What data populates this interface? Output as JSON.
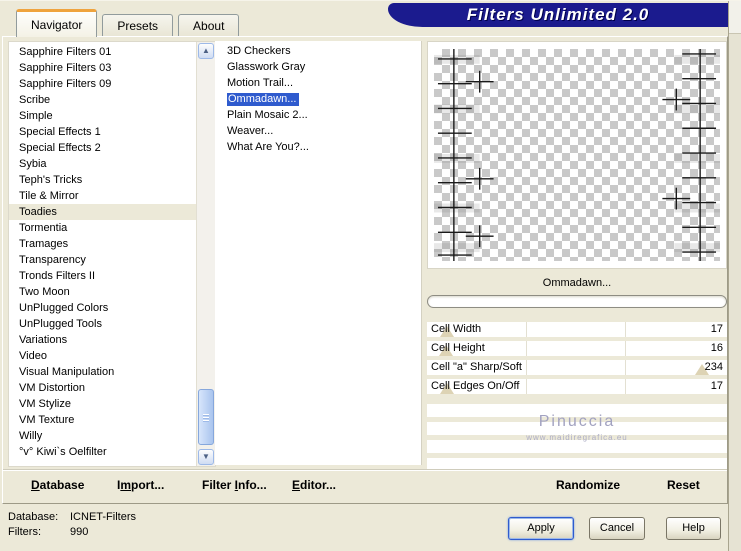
{
  "window": {
    "title_banner": "Filters Unlimited 2.0"
  },
  "tabs": [
    {
      "label": "Navigator",
      "active": true
    },
    {
      "label": "Presets",
      "active": false
    },
    {
      "label": "About",
      "active": false
    }
  ],
  "category_list": {
    "selected_index": 10,
    "items": [
      "Sapphire Filters 01",
      "Sapphire Filters 03",
      "Sapphire Filters 09",
      "Scribe",
      "Simple",
      "Special Effects 1",
      "Special Effects 2",
      "Sybia",
      "Teph's Tricks",
      "Tile & Mirror",
      "Toadies",
      "Tormentia",
      "Tramages",
      "Transparency",
      "Tronds Filters II",
      "Two Moon",
      "UnPlugged Colors",
      "UnPlugged Tools",
      "Variations",
      "Video",
      "Visual Manipulation",
      "VM Distortion",
      "VM Stylize",
      "VM Texture",
      "Willy",
      "°v° Kiwi`s Oelfilter"
    ]
  },
  "filter_list": {
    "selected_index": 3,
    "items": [
      "3D Checkers",
      "Glasswork Gray",
      "Motion Trail...",
      "Ommadawn...",
      "Plain Mosaic 2...",
      "Weaver...",
      "What Are You?..."
    ]
  },
  "preview": {
    "caption": "Ommadawn...",
    "progress_percent": 0
  },
  "controls": {
    "max": 255,
    "sliders": [
      {
        "label": "Cell Width",
        "value": 17
      },
      {
        "label": "Cell Height",
        "value": 16
      },
      {
        "label": "Cell \"a\" Sharp/Soft",
        "value": 234
      },
      {
        "label": "Cell Edges On/Off",
        "value": 17
      }
    ]
  },
  "watermark": {
    "name": "Pinuccia",
    "url": "www.maidiregrafica.eu"
  },
  "toolbar": {
    "items": [
      {
        "pre": "",
        "mn": "D",
        "post": "atabase"
      },
      {
        "pre": "I",
        "mn": "m",
        "post": "port..."
      },
      {
        "pre": "Filter ",
        "mn": "I",
        "post": "nfo..."
      },
      {
        "pre": "",
        "mn": "E",
        "post": "ditor..."
      },
      {
        "pre": "Randomize",
        "mn": "",
        "post": ""
      },
      {
        "pre": "Reset",
        "mn": "",
        "post": ""
      }
    ]
  },
  "status": {
    "rows": [
      {
        "label": "Database:",
        "value": "ICNET-Filters"
      },
      {
        "label": "Filters:",
        "value": "990"
      }
    ]
  },
  "dialog_buttons": [
    {
      "label": "Apply",
      "default": true
    },
    {
      "label": "Cancel",
      "default": false
    },
    {
      "label": "Help",
      "default": false
    }
  ],
  "colors": {
    "banner": "#1b1b8e",
    "selection": "#2f5bce",
    "tab_accent": "#efa33d",
    "dialog_bg": "#ece9d8"
  }
}
